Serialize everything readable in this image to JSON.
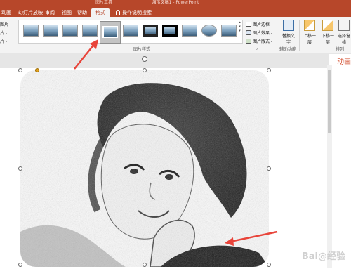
{
  "window": {
    "context_group": "图片工具",
    "title": "演示文稿1 - PowerPoint"
  },
  "tabs": [
    {
      "label": "动画",
      "active": false
    },
    {
      "label": "幻灯片放映",
      "active": false
    },
    {
      "label": "审阅",
      "active": false
    },
    {
      "label": "视图",
      "active": false
    },
    {
      "label": "帮助",
      "active": false
    },
    {
      "label": "格式",
      "active": true
    }
  ],
  "tell_me": {
    "label": "操作说明搜索"
  },
  "ribbon": {
    "left_commands": [
      "图片",
      "片 -",
      "片 -"
    ],
    "picture_styles": {
      "group_label": "图片样式",
      "right_commands": [
        {
          "label": "图片边框 -",
          "icon": "pencil-border-icon"
        },
        {
          "label": "图片效果 -",
          "icon": "picture-effects-icon"
        },
        {
          "label": "图片版式 -",
          "icon": "picture-layout-icon"
        }
      ]
    },
    "accessibility": {
      "button_label": "替换文字",
      "group_label": "辅助功能"
    },
    "arrange": {
      "group_label": "排列",
      "buttons": [
        "上移一层",
        "下移一层",
        "选择窗格"
      ]
    }
  },
  "pane": {
    "title": "动画"
  },
  "watermark": {
    "text": "Bai@经验"
  },
  "colors": {
    "ribbon_accent": "#b7472a",
    "annotation_arrow": "#e8443a",
    "adjust_handle": "#e0a020"
  }
}
